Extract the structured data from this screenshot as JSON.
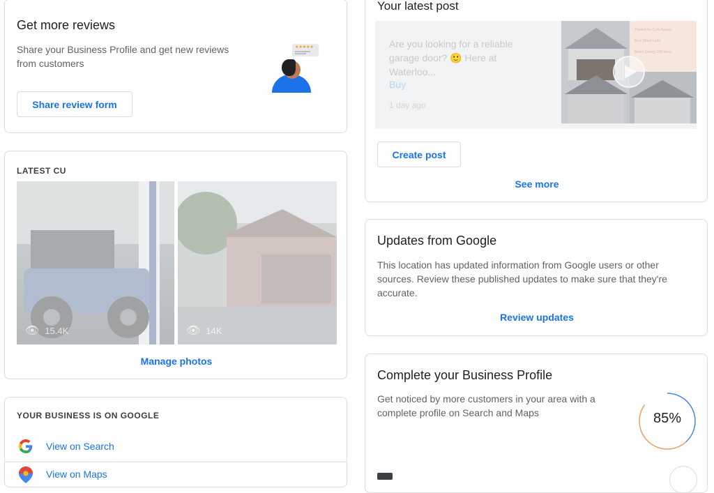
{
  "reviews": {
    "title": "Get more reviews",
    "description": "Share your Business Profile and get new reviews from customers",
    "button": "Share review form",
    "illustration_stars": "★★★★★"
  },
  "photos": {
    "label": "LATEST CU",
    "items": [
      {
        "views": "15.4K"
      },
      {
        "views": "14K"
      }
    ],
    "manage_link": "Manage photos"
  },
  "on_google": {
    "label": "YOUR BUSINESS IS ON GOOGLE",
    "items": [
      {
        "label": "View on Search",
        "icon": "google-g-icon"
      },
      {
        "label": "View on Maps",
        "icon": "maps-pin-icon"
      }
    ]
  },
  "latest_post": {
    "title": "Your latest post",
    "text": "Are you looking for a reliable garage door? 🙂 Here at Waterloo...",
    "action": "Buy",
    "time": "1 day ago",
    "image_lines": [
      "Trusted for Curb Appeal",
      "Best Street Light",
      "Better Energy Efficiency"
    ],
    "create_button": "Create post",
    "see_more": "See more"
  },
  "updates": {
    "title": "Updates from Google",
    "description": "This location has updated information from Google users or other sources. Review these published updates to make sure that they're accurate.",
    "link": "Review updates"
  },
  "complete": {
    "title": "Complete your Business Profile",
    "description": "Get noticed by more customers in your area with a complete profile on Search and Maps",
    "percent_label": "85%",
    "percent": 0.85
  },
  "colors": {
    "link": "#1a73e8",
    "border": "#dadce0",
    "progress_blue": "#4285f4",
    "progress_orange": "#e8a061"
  }
}
